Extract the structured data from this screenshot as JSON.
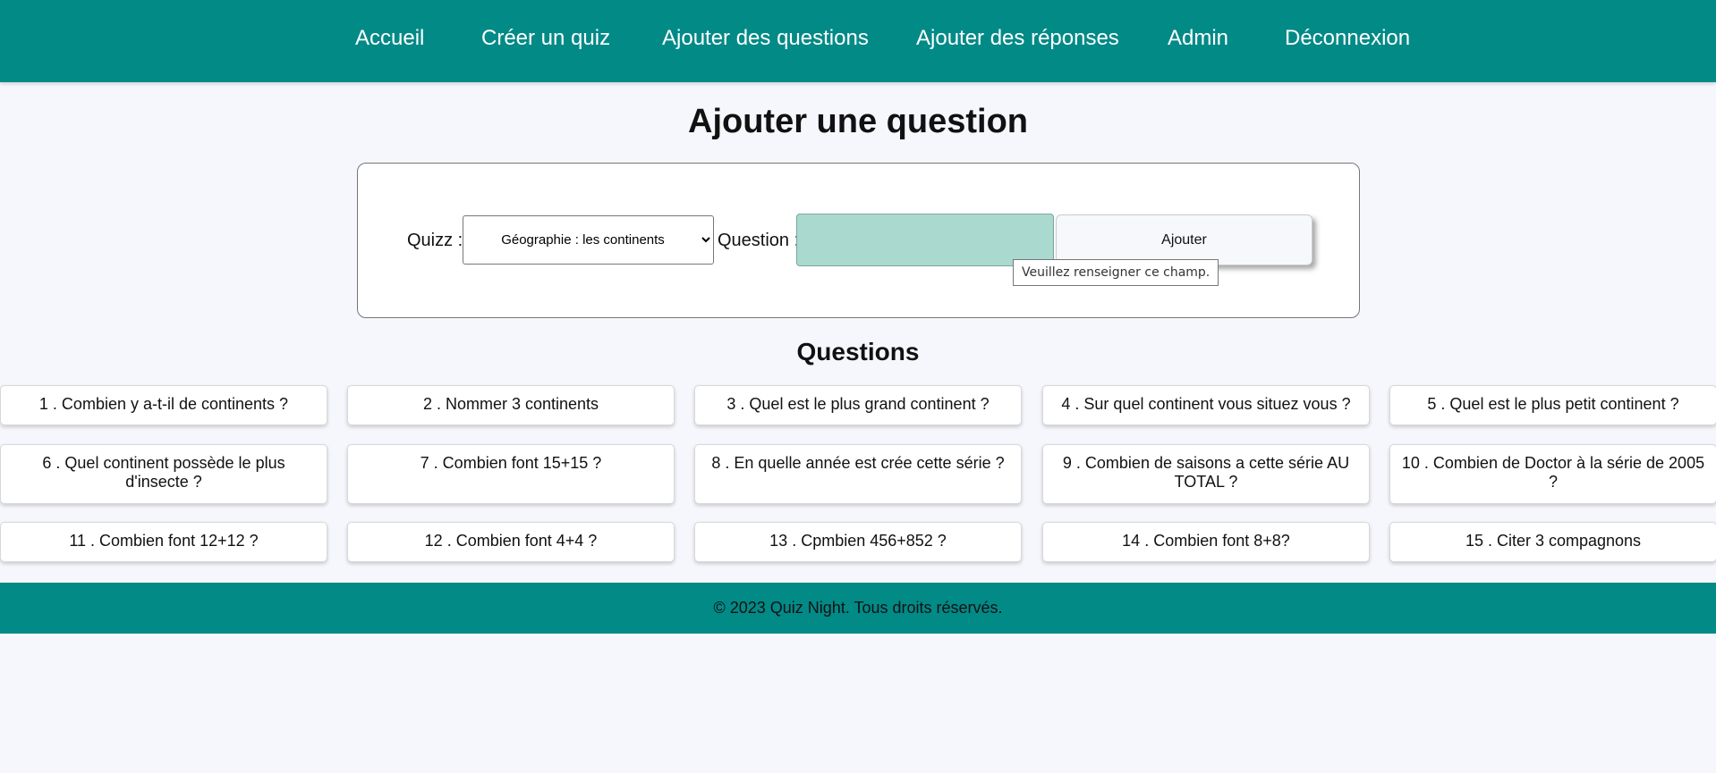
{
  "nav": {
    "items": [
      {
        "label": "Accueil"
      },
      {
        "label": "Créer un quiz"
      },
      {
        "label": "Ajouter des questions"
      },
      {
        "label": "Ajouter des réponses"
      },
      {
        "label": "Admin"
      },
      {
        "label": "Déconnexion"
      }
    ]
  },
  "page": {
    "title": "Ajouter une question"
  },
  "form": {
    "quiz_label": "Quizz :",
    "quiz_selected": "Géographie : les continents",
    "question_label": "Question :",
    "question_value": "",
    "submit_label": "Ajouter",
    "validation_tooltip": "Veuillez renseigner ce champ."
  },
  "questions": {
    "title": "Questions",
    "items": [
      {
        "text": "1 . Combien y a-t-il de continents ?"
      },
      {
        "text": "2 . Nommer 3 continents"
      },
      {
        "text": "3 . Quel est le plus grand continent ?"
      },
      {
        "text": "4 . Sur quel continent vous situez vous ?"
      },
      {
        "text": "5 . Quel est le plus petit continent ?"
      },
      {
        "text": "6 . Quel continent possède le plus d'insecte ?"
      },
      {
        "text": "7 . Combien font 15+15 ?"
      },
      {
        "text": "8 . En quelle année est crée cette série ?"
      },
      {
        "text": "9 . Combien de saisons a cette série AU TOTAL ?"
      },
      {
        "text": "10 . Combien de Doctor à la série de 2005 ?"
      },
      {
        "text": "11 . Combien font 12+12 ?"
      },
      {
        "text": "12 . Combien font 4+4 ?"
      },
      {
        "text": "13 . Cpmbien 456+852 ?"
      },
      {
        "text": "14 . Combien font 8+8?"
      },
      {
        "text": "15 . Citer 3 compagnons"
      }
    ]
  },
  "footer": {
    "text": "© 2023 Quiz Night. Tous droits réservés."
  },
  "colors": {
    "primary": "#028a87",
    "background": "#f6f7fc",
    "input_fill": "#aad9cf"
  }
}
